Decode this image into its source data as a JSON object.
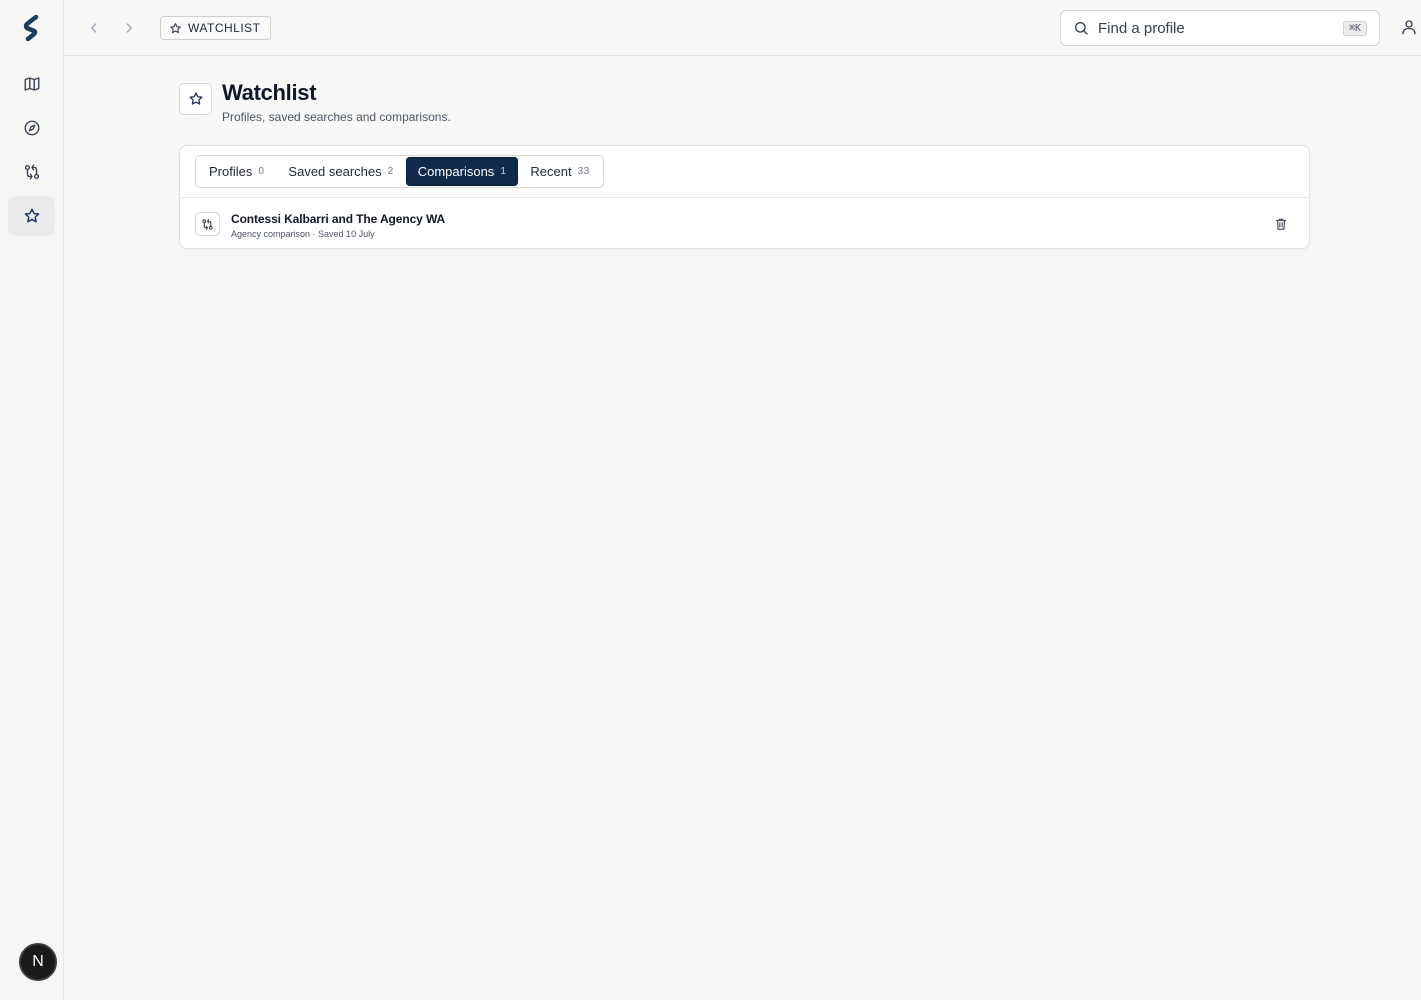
{
  "sidebar": {
    "items": [
      {
        "icon": "map-icon"
      },
      {
        "icon": "compass-icon"
      },
      {
        "icon": "compare-icon"
      },
      {
        "icon": "star-icon",
        "active": true
      }
    ],
    "avatar_initial": "N"
  },
  "topbar": {
    "breadcrumb": "WATCHLIST",
    "search": {
      "placeholder": "Find a profile",
      "shortcut": "⌘K"
    }
  },
  "page": {
    "title": "Watchlist",
    "subtitle": "Profiles, saved searches and comparisons."
  },
  "tabs": [
    {
      "label": "Profiles",
      "count": "0",
      "active": false
    },
    {
      "label": "Saved searches",
      "count": "2",
      "active": false
    },
    {
      "label": "Comparisons",
      "count": "1",
      "active": true
    },
    {
      "label": "Recent",
      "count": "33",
      "active": false
    }
  ],
  "comparisons": [
    {
      "title": "Contessi Kalbarri and The Agency WA",
      "meta": "Agency comparison · Saved 10 July"
    }
  ],
  "colors": {
    "accent": "#0f2a4a",
    "background": "#f8f8f7"
  }
}
